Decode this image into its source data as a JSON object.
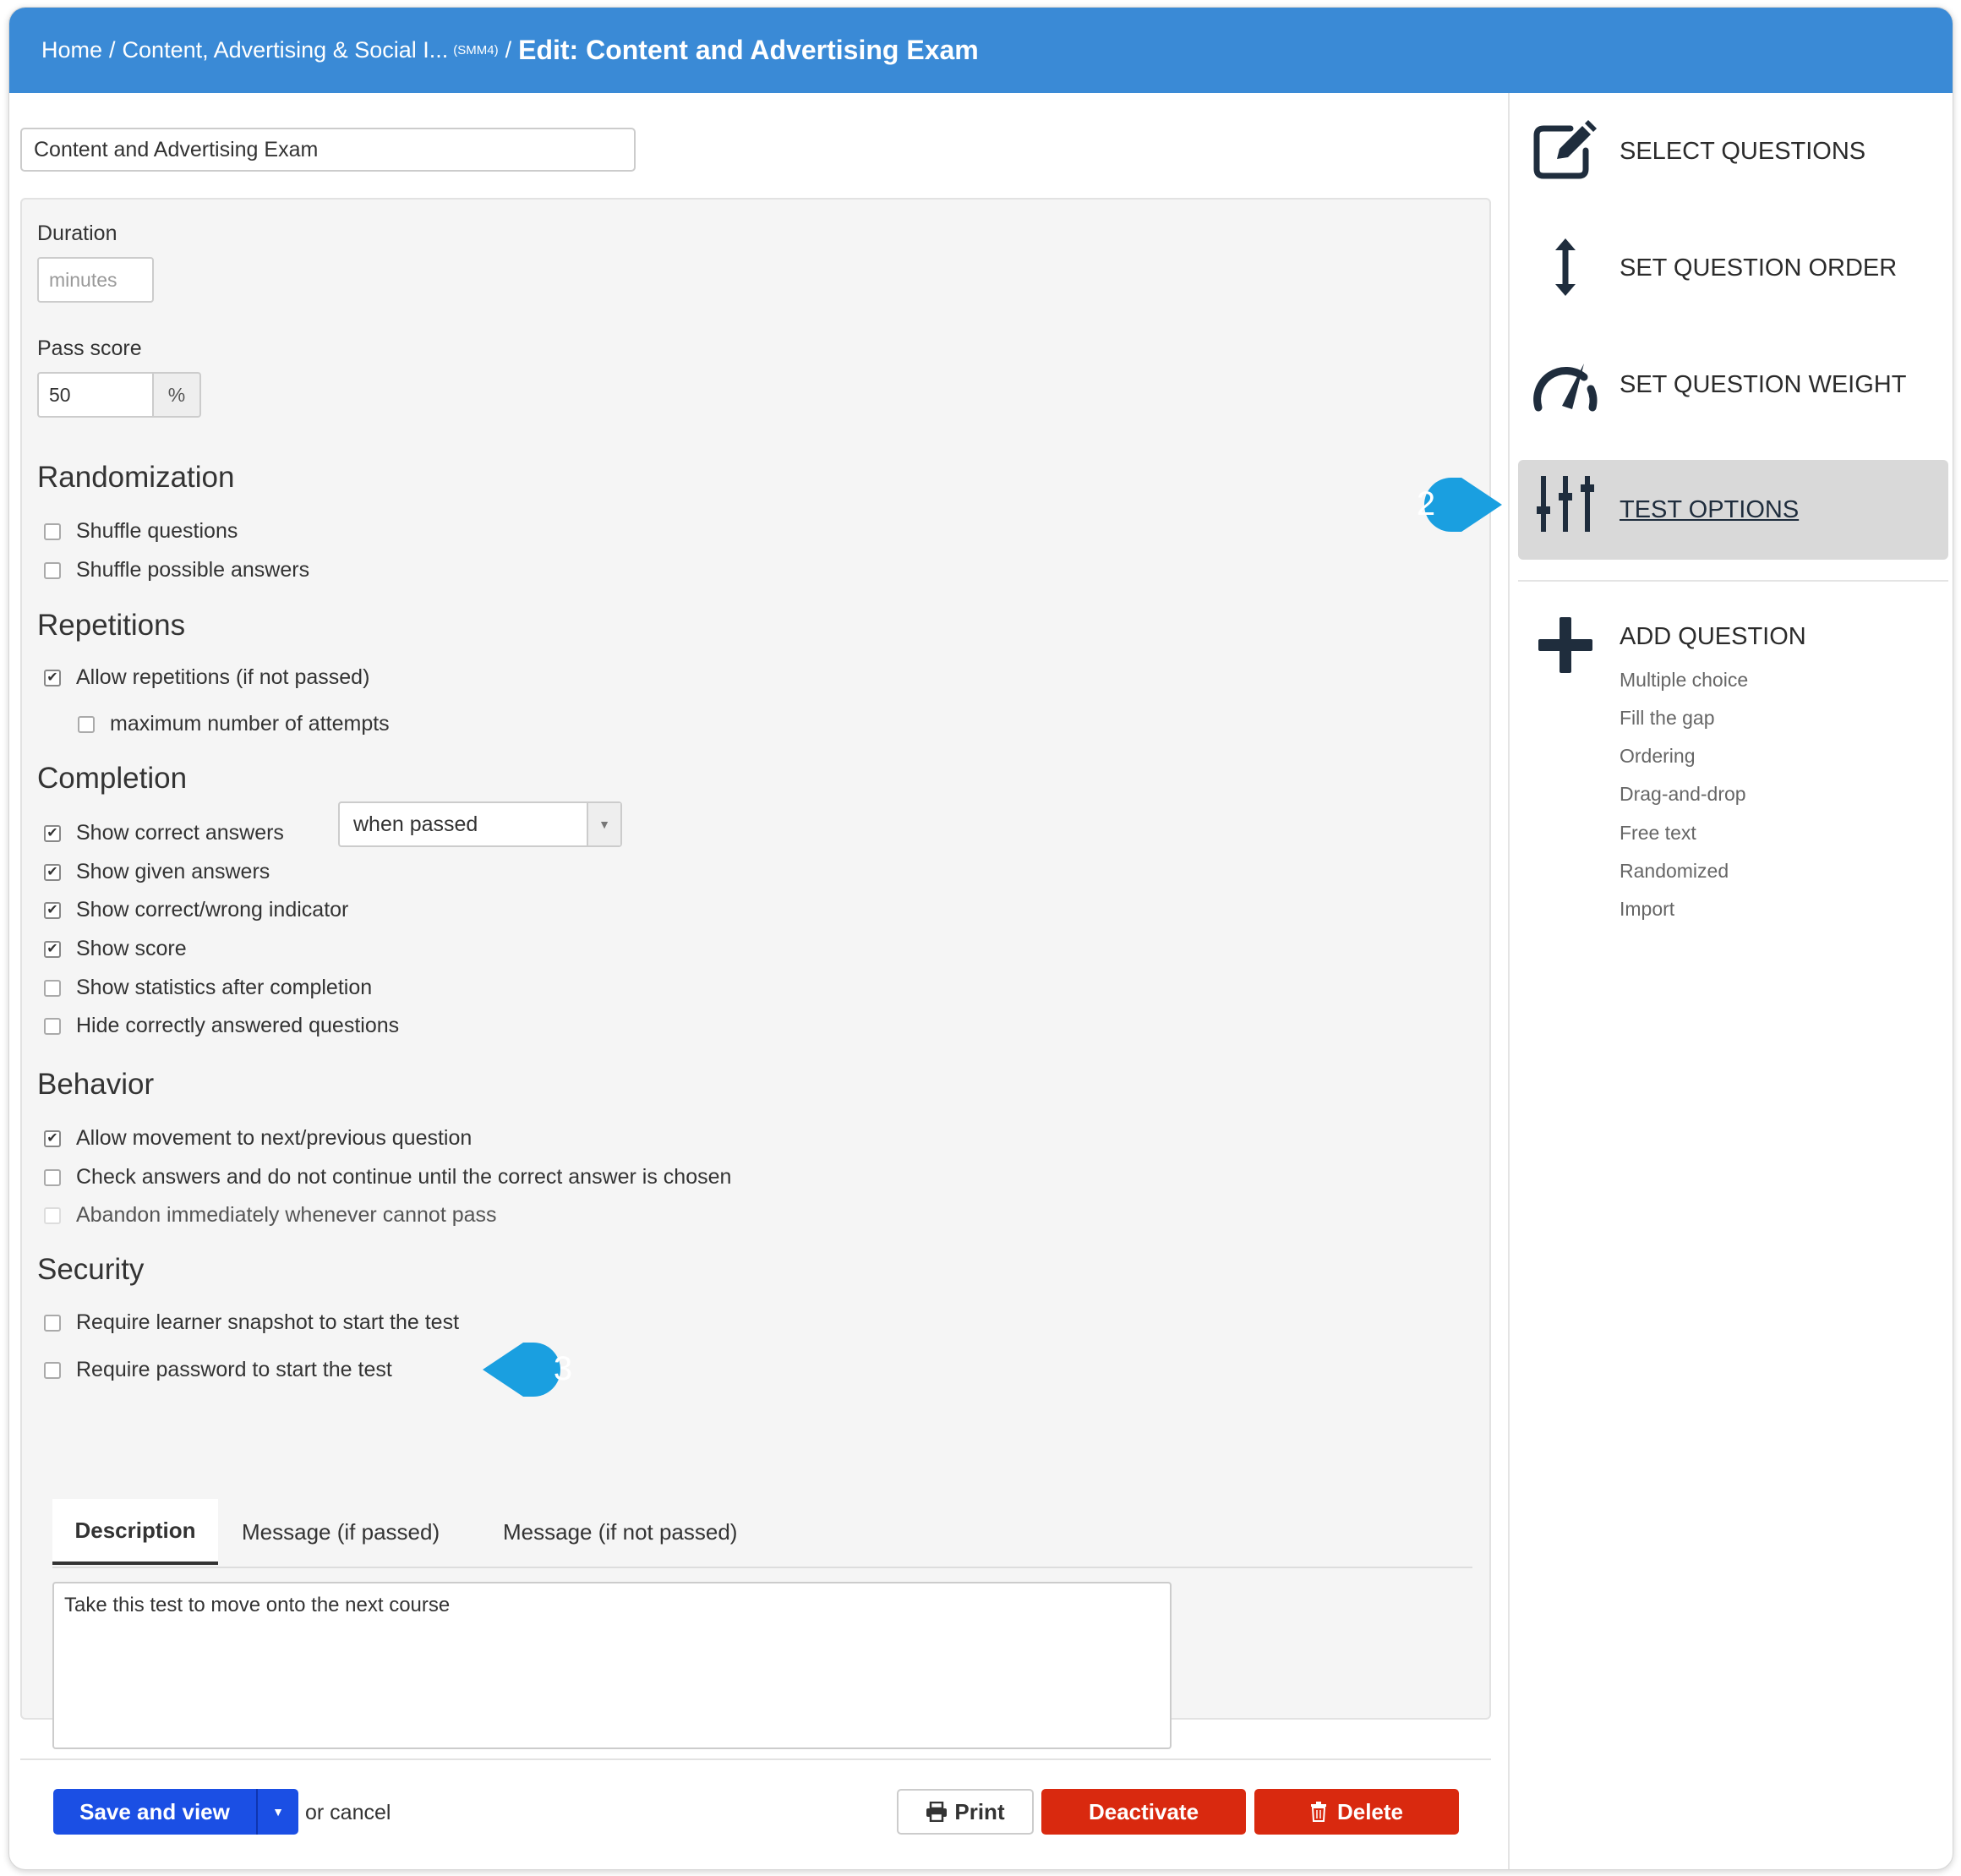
{
  "header": {
    "breadcrumb_home": "Home",
    "breadcrumb_course": "Content, Advertising & Social I...",
    "breadcrumb_course_code": "(SMM4)",
    "breadcrumb_current": "Edit: Content and Advertising Exam",
    "separator": "/"
  },
  "form": {
    "title_value": "Content and Advertising Exam",
    "duration_label": "Duration",
    "duration_placeholder": "minutes",
    "pass_score_label": "Pass score",
    "pass_score_value": "50",
    "pass_score_unit": "%"
  },
  "randomization": {
    "title": "Randomization",
    "options": [
      {
        "label": "Shuffle questions",
        "checked": false
      },
      {
        "label": "Shuffle possible answers",
        "checked": false
      }
    ]
  },
  "repetitions": {
    "title": "Repetitions",
    "allow_label": "Allow repetitions (if not passed)",
    "max_attempts_label": "maximum number of attempts"
  },
  "completion": {
    "title": "Completion",
    "show_correct_label": "Show correct answers",
    "show_correct_select": "when passed",
    "options": [
      {
        "label": "Show given answers",
        "checked": true
      },
      {
        "label": "Show correct/wrong indicator",
        "checked": true
      },
      {
        "label": "Show score",
        "checked": true
      },
      {
        "label": "Show statistics after completion",
        "checked": false
      },
      {
        "label": "Hide correctly answered questions",
        "checked": false
      }
    ]
  },
  "behavior": {
    "title": "Behavior",
    "options": [
      {
        "label": "Allow movement to next/previous question",
        "checked": true
      },
      {
        "label": "Check answers and do not continue until the correct answer is chosen",
        "checked": false
      },
      {
        "label": "Abandon immediately whenever cannot pass",
        "checked": false,
        "disabled": true
      }
    ]
  },
  "security": {
    "title": "Security",
    "options": [
      {
        "label": "Require learner snapshot to start the test",
        "checked": false
      },
      {
        "label": "Require password to start the test",
        "checked": false
      }
    ]
  },
  "tabs": [
    {
      "label": "Description",
      "active": true
    },
    {
      "label": "Message (if passed)",
      "active": false
    },
    {
      "label": "Message (if not passed)",
      "active": false
    }
  ],
  "description_text": "Take this test to move onto the next course",
  "footer": {
    "save_label": "Save and view",
    "cancel_text": "or cancel",
    "print_label": "Print",
    "deactivate_label": "Deactivate",
    "delete_label": "Delete"
  },
  "callouts": {
    "two": "2",
    "three": "3"
  },
  "sidebar": {
    "items": [
      {
        "label": "SELECT QUESTIONS",
        "icon": "edit-icon"
      },
      {
        "label": "SET QUESTION ORDER",
        "icon": "vertical-arrows-icon"
      },
      {
        "label": "SET QUESTION WEIGHT",
        "icon": "gauge-icon"
      },
      {
        "label": "TEST OPTIONS",
        "icon": "sliders-icon",
        "active": true
      }
    ],
    "add_question": {
      "label": "ADD QUESTION",
      "icon": "plus-icon",
      "types": [
        "Multiple choice",
        "Fill the gap",
        "Ordering",
        "Drag-and-drop",
        "Free text",
        "Randomized",
        "Import"
      ]
    }
  },
  "colors": {
    "header": "#3a8ad6",
    "primary": "#1b4fe4",
    "danger": "#d9290f",
    "callout": "#1a9fe0",
    "icon": "#1f2d3d"
  }
}
